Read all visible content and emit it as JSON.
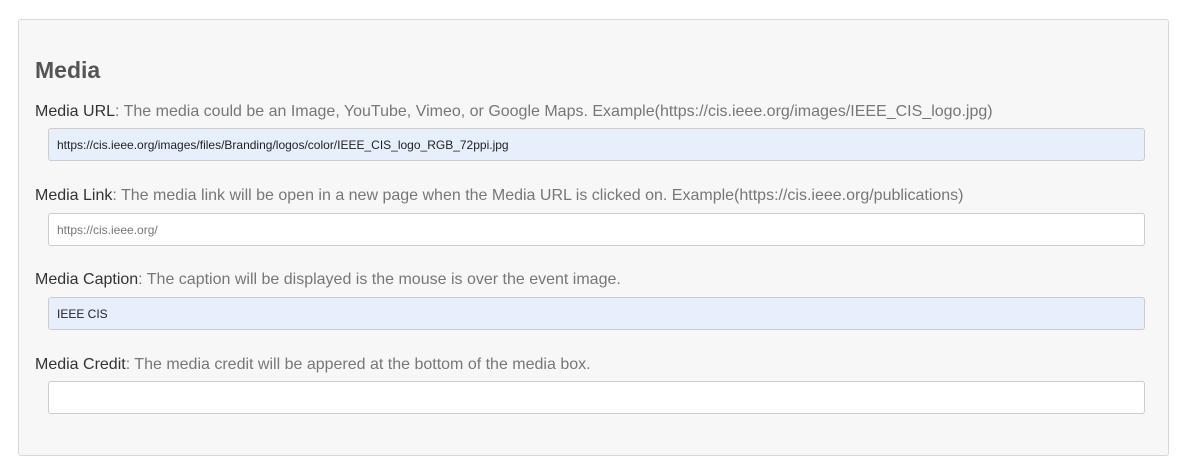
{
  "section": {
    "title": "Media"
  },
  "fields": [
    {
      "label": "Media URL",
      "description": ": The media could be an Image, YouTube, Vimeo, or Google Maps. Example(https://cis.ieee.org/images/IEEE_CIS_logo.jpg)",
      "value": "https://cis.ieee.org/images/files/Branding/logos/color/IEEE_CIS_logo_RGB_72ppi.jpg",
      "placeholder": ""
    },
    {
      "label": "Media Link",
      "description": ": The media link will be open in a new page when the Media URL is clicked on. Example(https://cis.ieee.org/publications)",
      "value": "",
      "placeholder": "https://cis.ieee.org/"
    },
    {
      "label": "Media Caption",
      "description": ": The caption will be displayed is the mouse is over the event image.",
      "value": "IEEE CIS",
      "placeholder": ""
    },
    {
      "label": "Media Credit",
      "description": ": The media credit will be appered at the bottom of the media box.",
      "value": "",
      "placeholder": ""
    }
  ]
}
